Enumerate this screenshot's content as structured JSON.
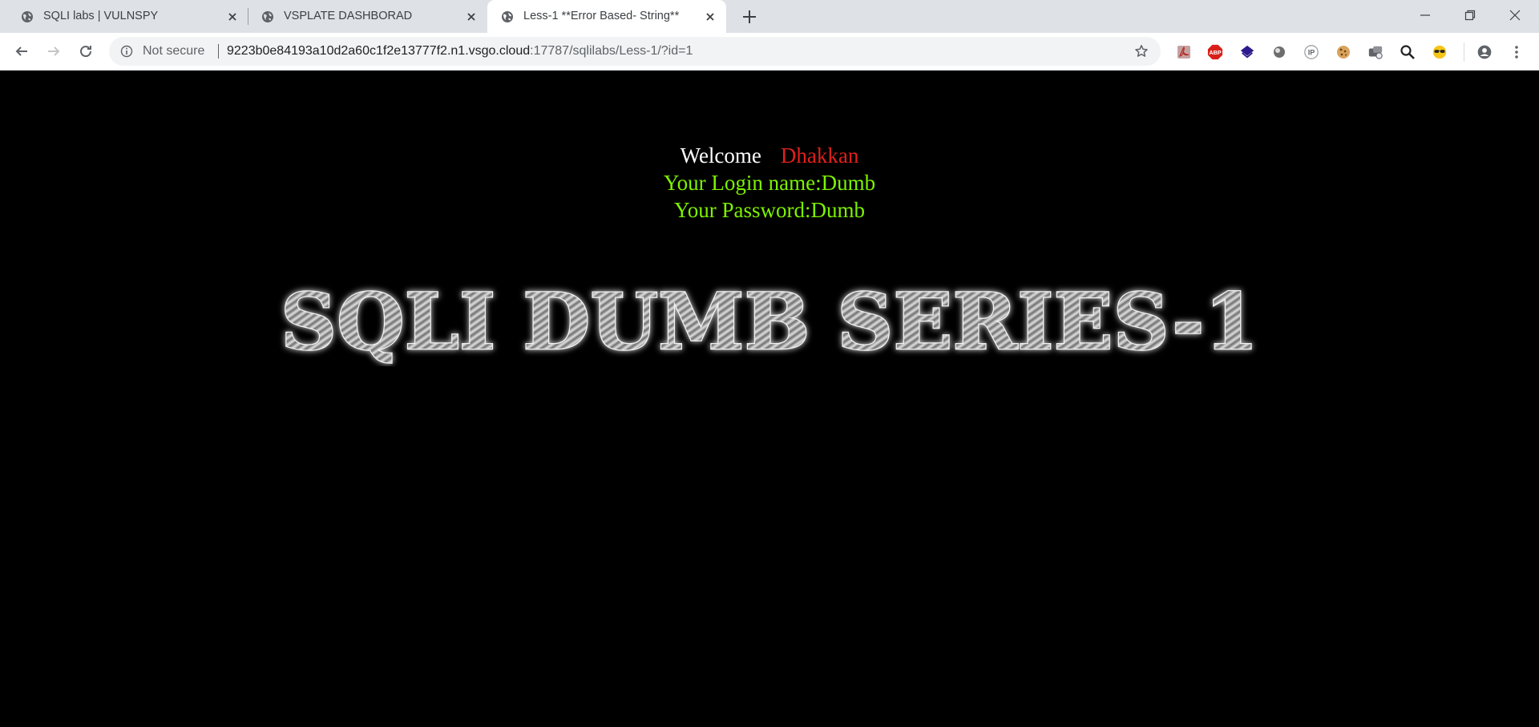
{
  "browser": {
    "tabs": [
      {
        "title": "SQLI labs | VULNSPY",
        "active": false
      },
      {
        "title": "VSPLATE DASHBORAD",
        "active": false
      },
      {
        "title": "Less-1 **Error Based- String**",
        "active": true
      }
    ],
    "address": {
      "security_label": "Not secure",
      "host": "9223b0e84193a10d2a60c1f2e13777f2.n1.vsgo.cloud",
      "path": ":17787/sqlilabs/Less-1/?id=1"
    },
    "extensions": [
      "pdf-icon",
      "adblock-plus-icon",
      "layers-icon",
      "circle-icon",
      "ip-icon",
      "cookie-icon",
      "gamepad-icon",
      "search-icon",
      "sunglasses-icon",
      "profile-icon",
      "menu-icon"
    ]
  },
  "page": {
    "welcome_word": "Welcome",
    "welcome_name": "Dhakkan",
    "login_line": "Your Login name:Dumb",
    "password_line": "Your Password:Dumb",
    "banner_text": "SQLI DUMB SERIES-1",
    "colors": {
      "background": "#000000",
      "welcome": "#ffffff",
      "name": "#e0201c",
      "credentials": "#7cf200"
    }
  }
}
